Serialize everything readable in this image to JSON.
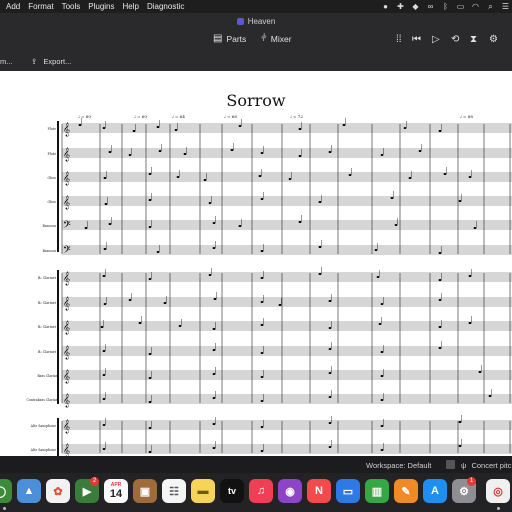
{
  "menubar": {
    "items": [
      "Add",
      "Format",
      "Tools",
      "Plugins",
      "Help",
      "Diagnostic"
    ]
  },
  "window": {
    "title": "Heaven"
  },
  "toolbar": {
    "parts_label": "Parts",
    "mixer_label": "Mixer"
  },
  "subbar": {
    "left_label": "m...",
    "export_label": "Export..."
  },
  "score": {
    "title": "Sorrow",
    "instruments": [
      "Flute 1",
      "Flute 2",
      "Oboe 1",
      "Oboe 2",
      "Bassoon 1",
      "Bassoon 2",
      "B♭ Clarinet 1",
      "B♭ Clarinet 2",
      "B♭ Clarinet 3",
      "B♭ Clarinet 4",
      "Bass Clarinet",
      "Contrabass Clarinet",
      "Alto Saxophone 1",
      "Alto Saxophone 2"
    ],
    "tempo_marks": [
      "♩ = 80",
      "♩ = 64",
      "♩ = 68",
      "♩ = 72",
      "♩ = 60",
      "♩ = 88"
    ]
  },
  "statusbar": {
    "workspace": "Workspace: Default",
    "concert_pitch": "Concert pitc"
  },
  "dock": {
    "calendar_month": "APR",
    "calendar_day": "14",
    "photos_badge": "2",
    "settings_badge": "1",
    "tv_label": "tv"
  },
  "colors": {
    "menubar": "#1e1e1f",
    "toolbar": "#2a2a2c",
    "score_bg": "#ffffff",
    "accent": "#5b57d6"
  }
}
